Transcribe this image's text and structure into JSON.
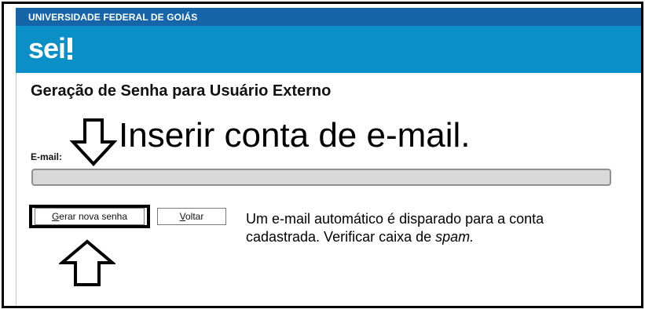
{
  "header": {
    "institution": "UNIVERSIDADE FEDERAL DE GOIÁS",
    "logo_text": "sei",
    "brand_color": "#0a8fc7",
    "topbar_color": "#1565a8"
  },
  "page": {
    "title": "Geração de Senha para Usuário Externo"
  },
  "annotations": {
    "instruction": "Inserir conta de e-mail.",
    "info_line1": "Um e-mail automático é disparado para a conta",
    "info_line2_prefix": "cadastrada. Verificar caixa de ",
    "info_line2_emphasis": "spam."
  },
  "form": {
    "email_label": "E-mail:",
    "email_value": ""
  },
  "buttons": {
    "generate_label": "Gerar nova senha",
    "back_label": "Voltar"
  }
}
